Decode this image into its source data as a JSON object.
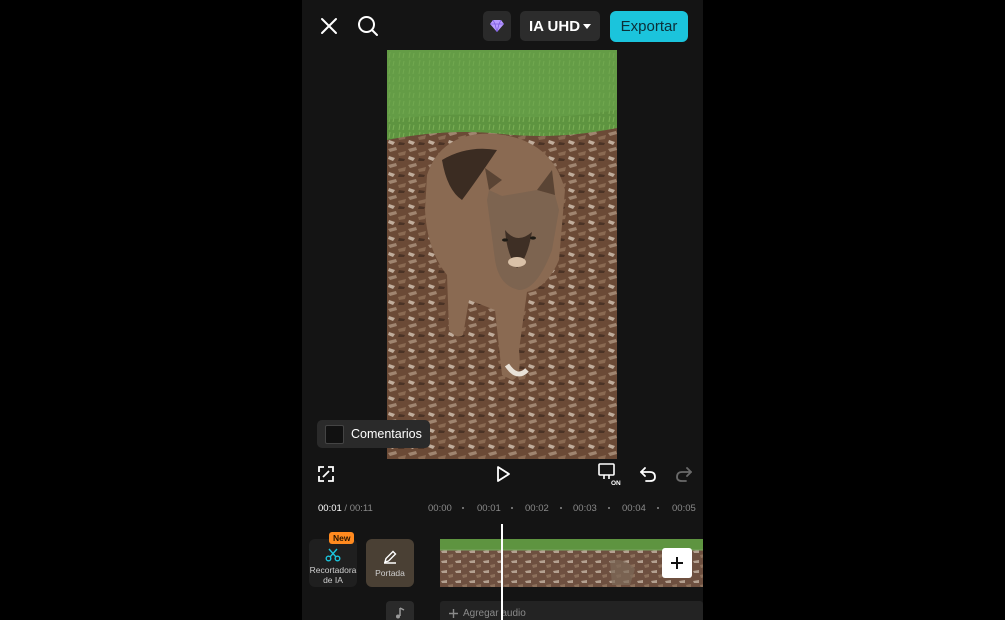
{
  "header": {
    "quality_label": "IA UHD",
    "export_label": "Exportar"
  },
  "preview": {
    "comments_label": "Comentarios"
  },
  "timeline": {
    "current_time": "00:01",
    "separator": " / ",
    "total_time": "00:11",
    "ruler": [
      "00:00",
      "00:01",
      "00:02",
      "00:03",
      "00:04",
      "00:05"
    ]
  },
  "tools": {
    "ai_cutout": {
      "badge": "New",
      "label_line1": "Recortadora",
      "label_line2": "de IA"
    },
    "cover": {
      "label": "Portada"
    },
    "add_audio_label": "Agregar audio"
  },
  "colors": {
    "accent": "#1bc4dc",
    "badge": "#ff8a1f",
    "background": "#141414"
  },
  "icons": [
    "close-icon",
    "search-icon",
    "gem-icon",
    "caret-down-icon",
    "fullscreen-icon",
    "play-icon",
    "device-on-icon",
    "undo-icon",
    "redo-icon",
    "scissors-icon",
    "pencil-icon",
    "plus-icon",
    "music-note-icon"
  ]
}
